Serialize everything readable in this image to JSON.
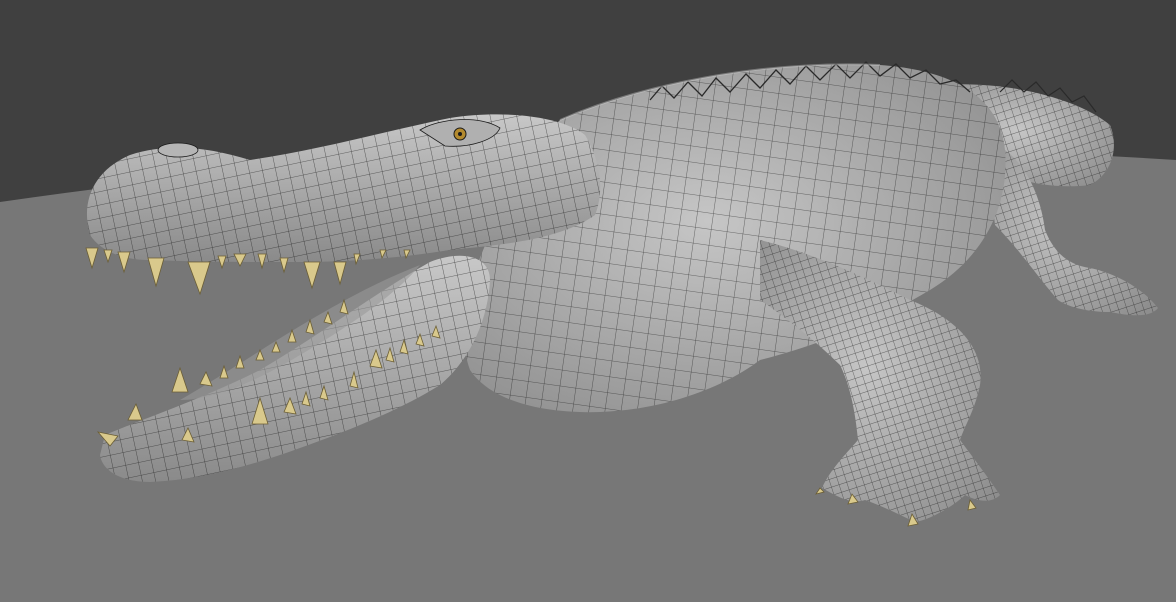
{
  "viewport": {
    "background_color": "#404040",
    "ground_color": "#777777"
  },
  "model": {
    "subject": "crocodile",
    "view": "wireframe-on-shaded",
    "mouth": "open",
    "colors": {
      "skin": "#a9a9a9",
      "skin_light": "#c4c4c4",
      "skin_shadow": "#8c8c8c",
      "wire": "#1a1a1a",
      "teeth": "#d9c98c",
      "teeth_edge": "#6b5e35",
      "eye": "#b38a2e"
    }
  }
}
